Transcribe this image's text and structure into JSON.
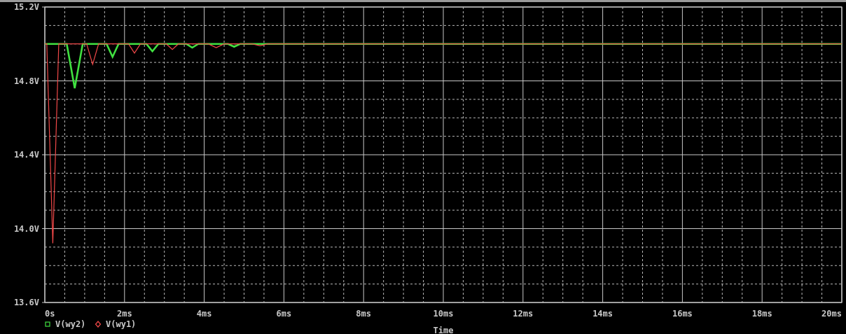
{
  "plot": {
    "chart_data": {
      "type": "line",
      "xlabel": "Time",
      "grid": true,
      "legend": true,
      "x": [
        0,
        0.05,
        0.2,
        0.35,
        0.55,
        0.75,
        0.95,
        1.05,
        1.2,
        1.35,
        1.55,
        1.7,
        1.85,
        2.1,
        2.25,
        2.4,
        2.55,
        2.7,
        2.85,
        3.05,
        3.2,
        3.35,
        3.55,
        3.7,
        3.85,
        4.1,
        4.3,
        4.5,
        4.6,
        4.75,
        4.9,
        5.2,
        5.4,
        5.6,
        20
      ],
      "xlim": [
        0,
        20
      ],
      "ylim": [
        13.6,
        15.2
      ],
      "xticks": [
        {
          "value": 0,
          "label": "0s"
        },
        {
          "value": 2,
          "label": "2ms"
        },
        {
          "value": 4,
          "label": "4ms"
        },
        {
          "value": 6,
          "label": "6ms"
        },
        {
          "value": 8,
          "label": "8ms"
        },
        {
          "value": 10,
          "label": "10ms"
        },
        {
          "value": 12,
          "label": "12ms"
        },
        {
          "value": 14,
          "label": "14ms"
        },
        {
          "value": 16,
          "label": "16ms"
        },
        {
          "value": 18,
          "label": "18ms"
        },
        {
          "value": 20,
          "label": "20ms"
        }
      ],
      "yticks": [
        {
          "value": 13.6,
          "label": "13.6V"
        },
        {
          "value": 14.0,
          "label": "14.0V"
        },
        {
          "value": 14.4,
          "label": "14.4V"
        },
        {
          "value": 14.8,
          "label": "14.8V"
        },
        {
          "value": 15.2,
          "label": "15.2V"
        }
      ],
      "series": [
        {
          "name": "V(wy2)",
          "color": "#40e040",
          "values": [
            15,
            15,
            15,
            15,
            15,
            14.76,
            15,
            15,
            15,
            15,
            15,
            14.93,
            15,
            15,
            15,
            15,
            15,
            14.96,
            15,
            15,
            15,
            15,
            15,
            14.98,
            15,
            15,
            15,
            15,
            15,
            14.985,
            15,
            15,
            15,
            15,
            15
          ]
        },
        {
          "name": "V(wy1)",
          "color": "#f04848",
          "values": [
            15,
            15,
            13.92,
            15,
            15,
            15,
            15,
            15,
            14.89,
            15,
            15,
            15,
            15,
            15,
            14.95,
            15,
            15,
            15,
            15,
            15,
            14.97,
            15,
            15,
            15,
            15,
            15,
            14.98,
            15,
            15,
            15,
            15,
            15,
            14.99,
            15,
            15
          ]
        }
      ]
    }
  }
}
